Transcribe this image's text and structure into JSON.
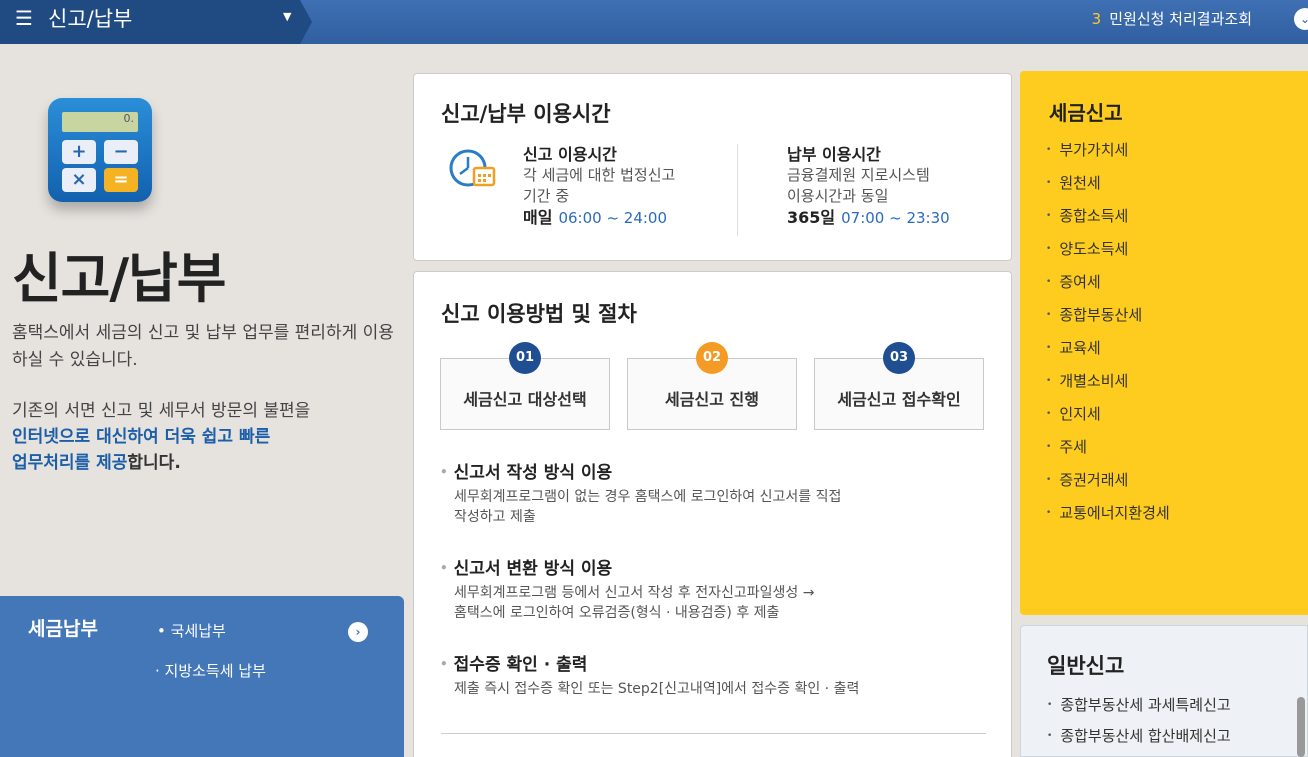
{
  "topbar": {
    "title": "신고/납부",
    "menu_icon": "☰",
    "caret": "▼",
    "count": "3",
    "right_link": "민원신청 처리결과조회",
    "right_icon": "⌄"
  },
  "intro": {
    "calc_display": "0.",
    "title": "신고/납부",
    "desc1": "홈택스에서 세금의 신고 및 납부 업무를 편리하게 이용하실 수 있습니다.",
    "desc2_a": "기존의 서면 신고 및 세무서 방문의 불편을",
    "desc2_b": "인터넷으로 대신하여 더욱 쉽고 빠른",
    "desc2_c": "업무처리를 제공",
    "desc2_d": "합니다."
  },
  "tax_payment": {
    "title": "세금납부",
    "item1": "• 국세납부",
    "item2": "· 지방소득세 납부",
    "arrow": "›"
  },
  "hours": {
    "title": "신고/납부 이용시간",
    "report_title": "신고 이용시간",
    "report_desc1": "각 세금에 대한 법정신고",
    "report_desc2": "기간 중",
    "report_day": "매일",
    "report_time": "06:00 ~ 24:00",
    "pay_title": "납부 이용시간",
    "pay_desc1": "금융결제원 지로시스템",
    "pay_desc2": "이용시간과 동일",
    "pay_day": "365일",
    "pay_time": "07:00 ~ 23:30"
  },
  "process": {
    "title": "신고 이용방법 및 절차",
    "steps": [
      {
        "num": "01",
        "label": "세금신고 대상선택"
      },
      {
        "num": "02",
        "label": "세금신고 진행"
      },
      {
        "num": "03",
        "label": "세금신고 접수확인"
      }
    ],
    "sections": [
      {
        "title": "신고서 작성 방식 이용",
        "desc1": "세무회계프로그램이 없는 경우 홈택스에 로그인하여 신고서를 직접",
        "desc2": "작성하고 제출"
      },
      {
        "title": "신고서 변환 방식 이용",
        "desc1": "세무회계프로그램 등에서 신고서 작성 후 전자신고파일생성 →",
        "desc2": "홈택스에 로그인하여 오류검증(형식 · 내용검증) 후 제출"
      },
      {
        "title": "접수증 확인 · 출력",
        "desc1": "제출 즉시 접수증 확인 또는 Step2[신고내역]에서 접수증 확인 · 출력",
        "desc2": ""
      }
    ]
  },
  "tax_report": {
    "title": "세금신고",
    "items": [
      "부가가치세",
      "원천세",
      "종합소득세",
      "양도소득세",
      "증여세",
      "종합부동산세",
      "교육세",
      "개별소비세",
      "인지세",
      "주세",
      "증권거래세",
      "교통에너지환경세"
    ]
  },
  "general_report": {
    "title": "일반신고",
    "items": [
      "종합부동산세 과세특례신고",
      "종합부동산세 합산배제신고"
    ]
  }
}
